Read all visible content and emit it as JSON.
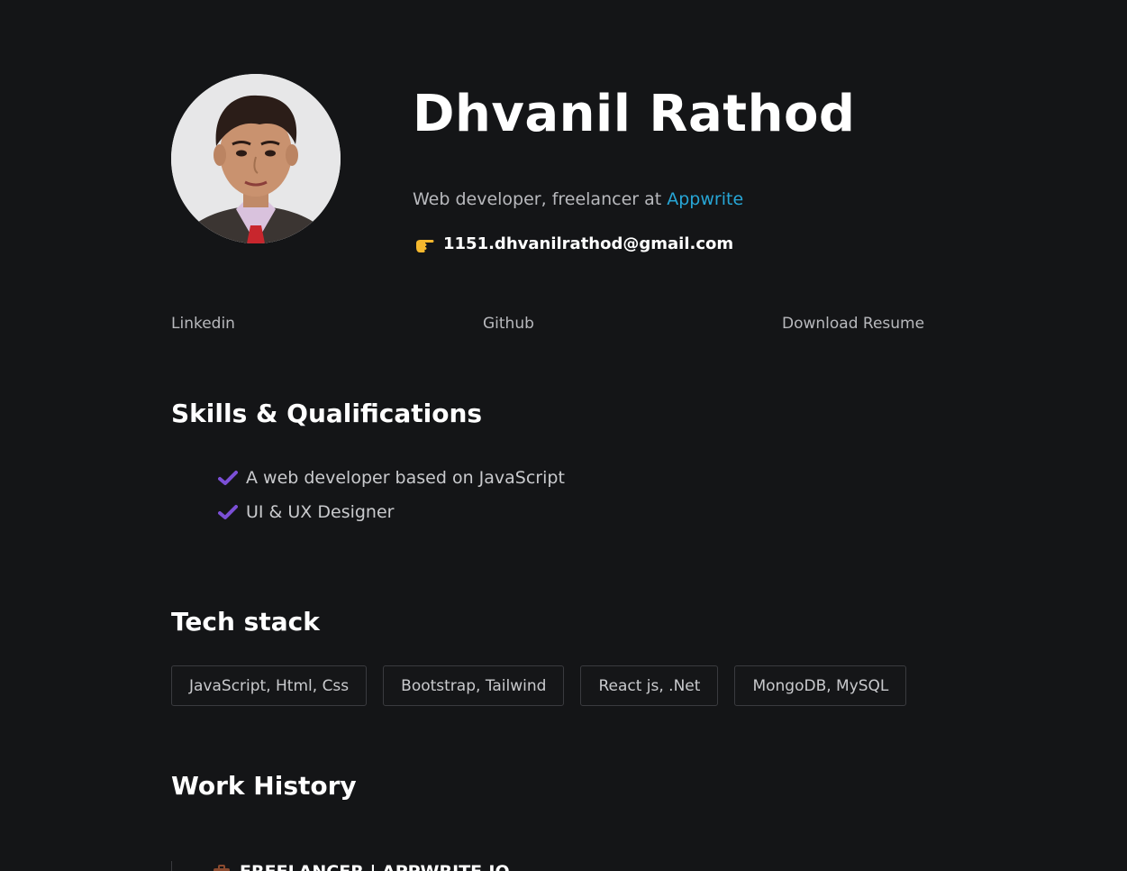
{
  "profile": {
    "name": "Dhvanil Rathod",
    "tagline_prefix": "Web developer, freelancer at ",
    "company": "Appwrite",
    "email": "1151.dhvanilrathod@gmail.com",
    "email_icon": "pointing-hand-icon",
    "avatar_alt": "profile photo"
  },
  "links": {
    "linkedin": "Linkedin",
    "github": "Github",
    "resume": "Download Resume"
  },
  "skills": {
    "title": "Skills & Qualifications",
    "items": [
      "A web developer based on JavaScript",
      "UI & UX Designer"
    ],
    "check_color": "#7b4fd6"
  },
  "tech": {
    "title": "Tech stack",
    "items": [
      "JavaScript, Html, Css",
      "Bootstrap, Tailwind",
      "React js, .Net",
      "MongoDB, MySQL"
    ]
  },
  "work": {
    "title": "Work History",
    "first_item": "FREELANCER | APPWRITE.IO"
  },
  "colors": {
    "background": "#141517",
    "accent_link": "#27a6d6",
    "muted_text": "#b8b9bd"
  }
}
